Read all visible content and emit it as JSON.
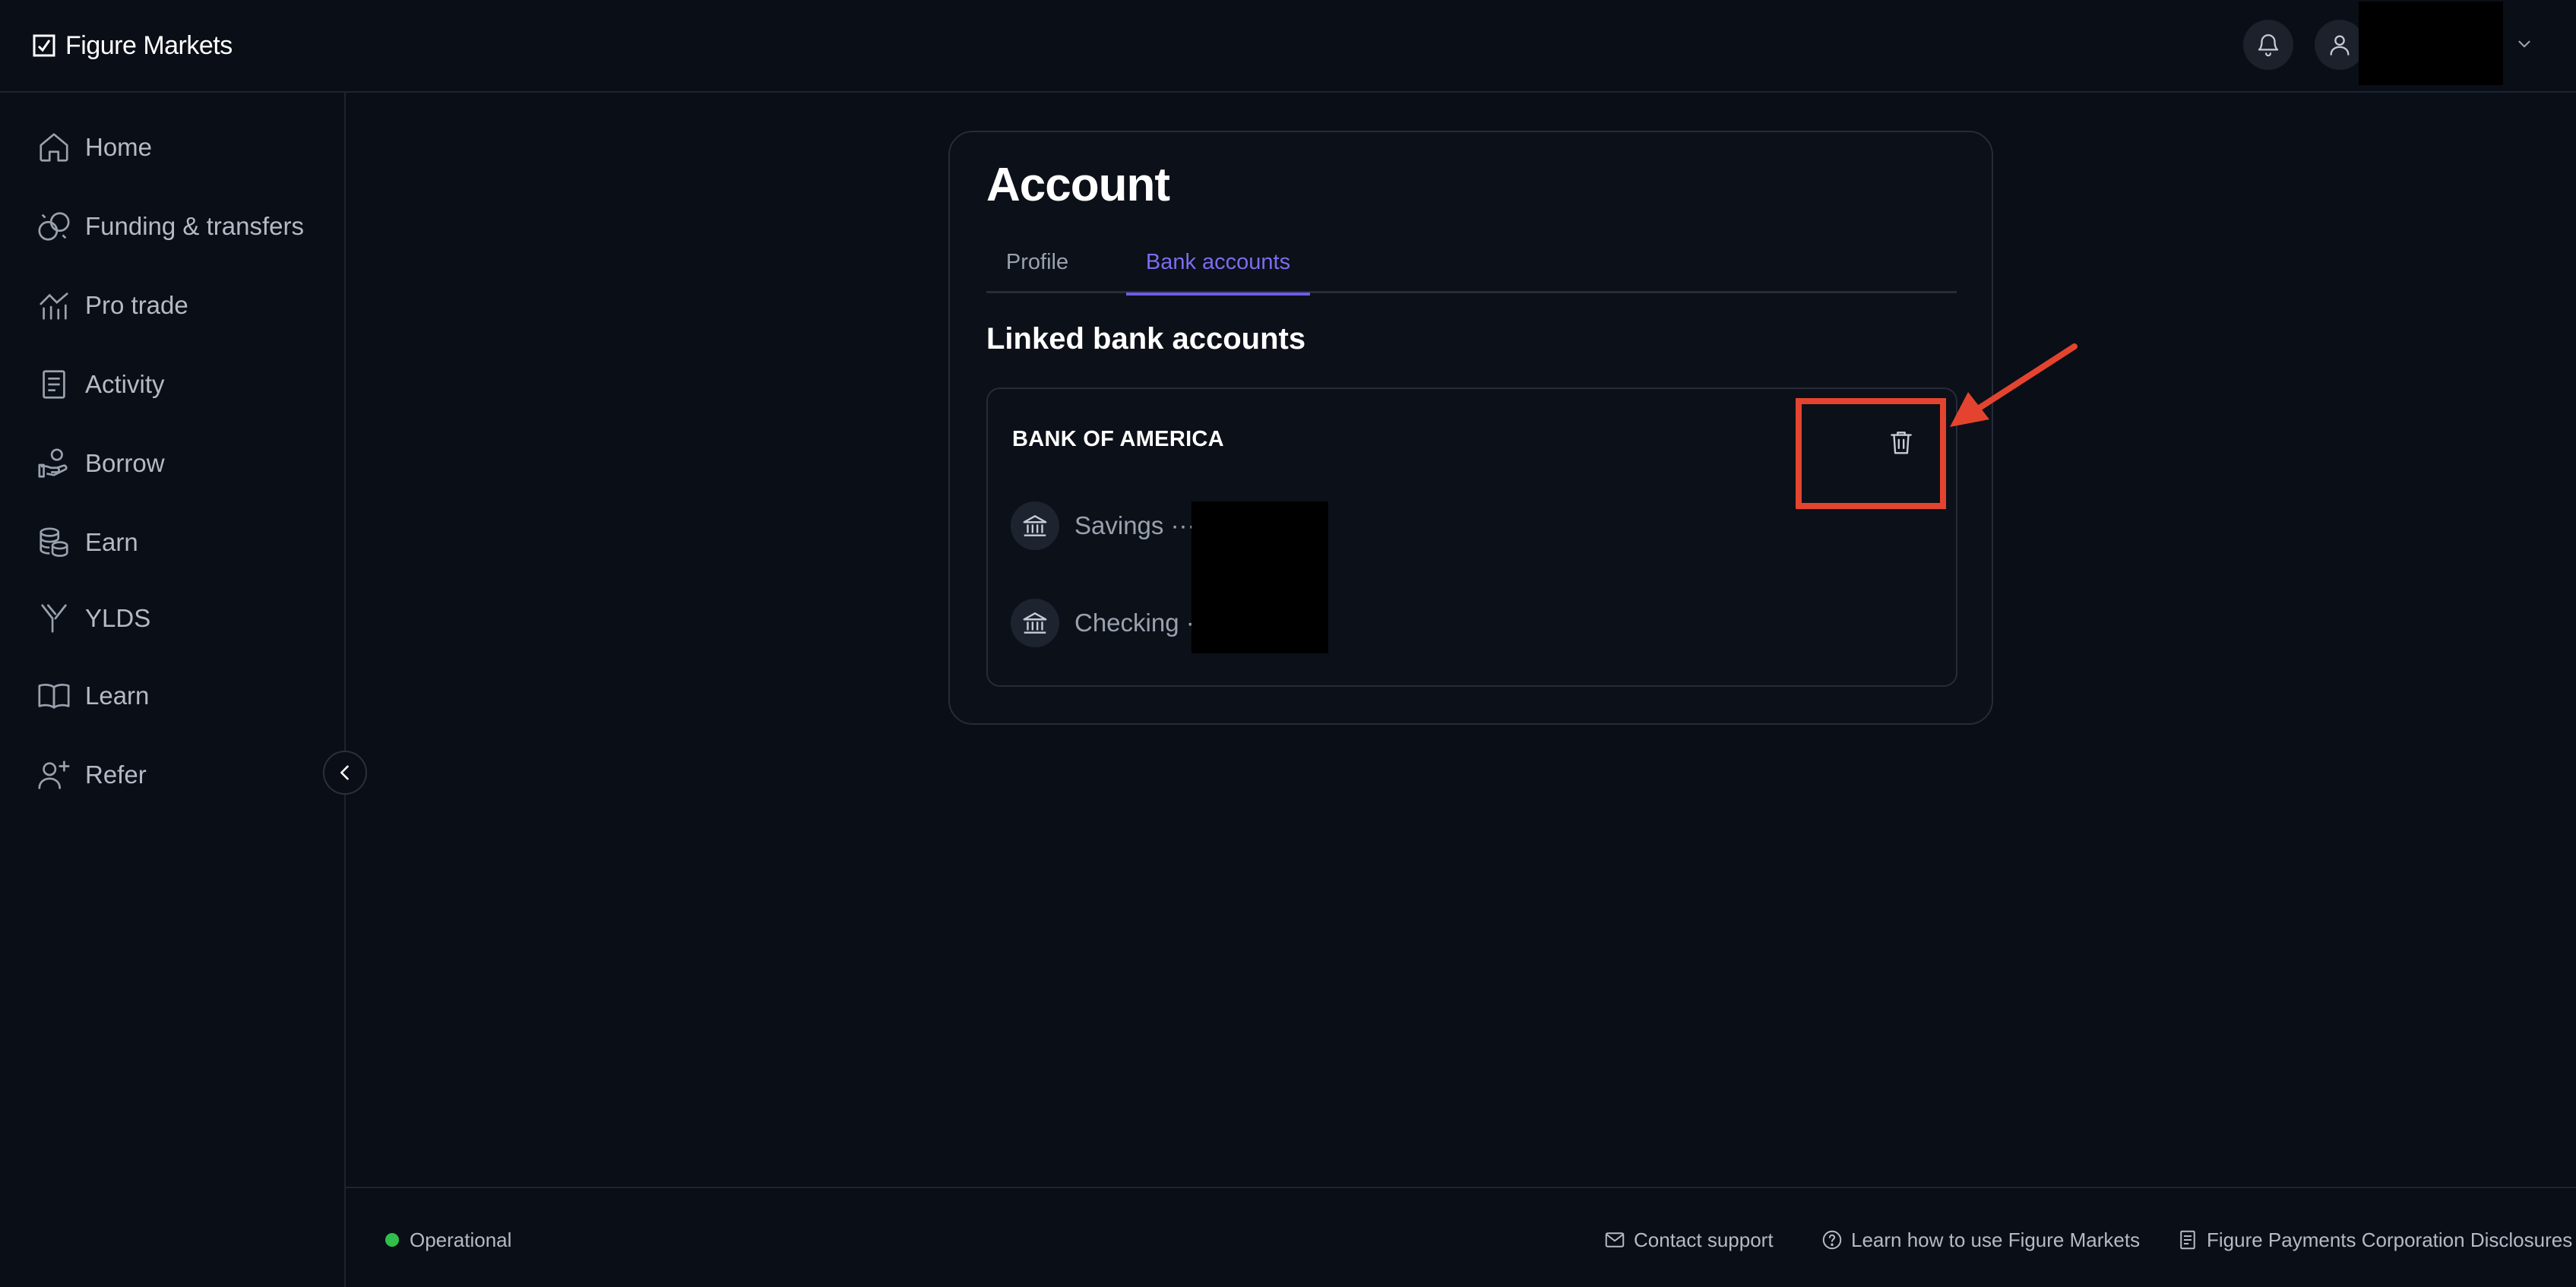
{
  "app": {
    "logo_text": "Figure Markets"
  },
  "header": {
    "notifications_icon": "bell-icon",
    "user_icon": "user-icon",
    "menu_icon": "chevron-down-icon"
  },
  "sidebar": {
    "items": [
      {
        "label": "Home",
        "icon": "home-icon"
      },
      {
        "label": "Funding & transfers",
        "icon": "coins-icon"
      },
      {
        "label": "Pro trade",
        "icon": "chart-icon"
      },
      {
        "label": "Activity",
        "icon": "document-icon"
      },
      {
        "label": "Borrow",
        "icon": "hand-coins-icon"
      },
      {
        "label": "Earn",
        "icon": "coin-stack-icon"
      },
      {
        "label": "YLDS",
        "icon": "ylds-icon"
      },
      {
        "label": "Learn",
        "icon": "book-icon"
      },
      {
        "label": "Refer",
        "icon": "user-plus-icon"
      }
    ],
    "collapse_icon": "chevron-left-icon"
  },
  "account": {
    "title": "Account",
    "tabs": [
      {
        "label": "Profile",
        "active": false
      },
      {
        "label": "Bank accounts",
        "active": true
      }
    ],
    "section_title": "Linked bank accounts",
    "bank": {
      "name": "BANK OF AMERICA",
      "delete_icon": "trash-icon",
      "accounts": [
        {
          "label": "Savings ····",
          "icon": "bank-icon"
        },
        {
          "label": "Checking ·",
          "icon": "bank-icon"
        }
      ]
    }
  },
  "footer": {
    "status": "Operational",
    "status_color": "#2fbf4a",
    "links": [
      {
        "label": "Contact support",
        "icon": "mail-icon"
      },
      {
        "label": "Learn how to use Figure Markets",
        "icon": "help-circle-icon"
      },
      {
        "label": "Figure Payments Corporation Disclosures",
        "icon": "document-icon"
      }
    ]
  },
  "colors": {
    "background": "#0a0e16",
    "accent": "#6b5ce8",
    "annotation": "#e4442f"
  }
}
